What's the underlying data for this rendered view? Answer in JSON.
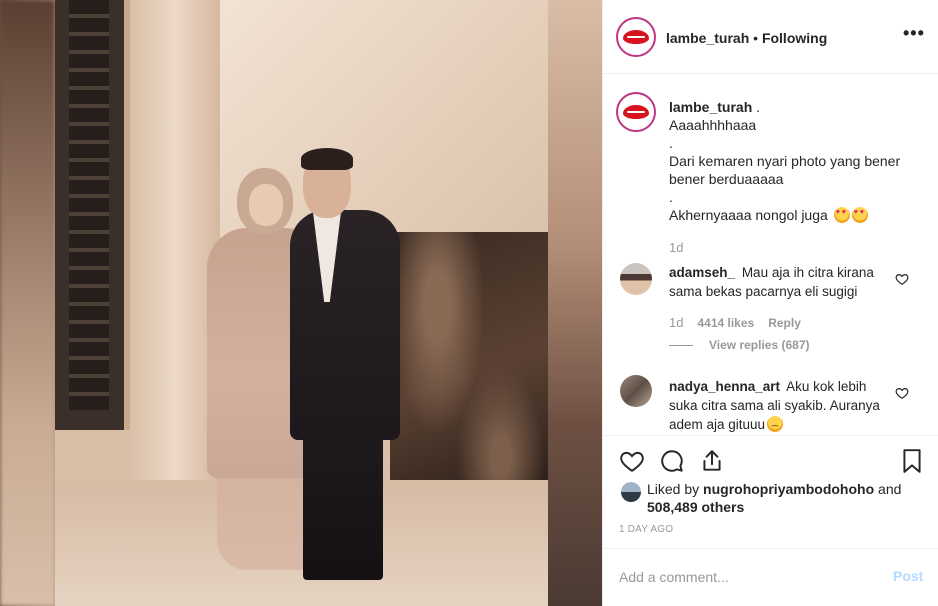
{
  "post": {
    "username": "lambe_turah",
    "separator": "•",
    "follow_status": "Following",
    "more_label": "•••"
  },
  "caption": {
    "username": "lambe_turah",
    "lines": [
      ".",
      "Aaaahhhhaaa",
      ".",
      "Dari kemaren nyari photo yang bener",
      "bener berduaaaaa",
      ".",
      "Akhernyaaaa nongol juga"
    ],
    "time": "1d"
  },
  "comments": [
    {
      "username": "adamseh_",
      "text": "Mau aja ih citra kirana sama bekas pacarnya eli sugigi",
      "time": "1d",
      "likes": "4414 likes",
      "reply_label": "Reply",
      "view_replies": "View replies (687)"
    },
    {
      "username": "nadya_henna_art",
      "text": "Aku kok lebih suka citra sama ali syakib. Auranya adem aja gituuu"
    }
  ],
  "likes": {
    "prefix": "Liked by",
    "user": "nugrohopriyambodohoho",
    "conjunction": "and",
    "others": "508,489 others"
  },
  "time_ago": "1 DAY AGO",
  "add_comment": {
    "placeholder": "Add a comment...",
    "post_label": "Post"
  },
  "icons": {
    "like": "heart-outline-icon",
    "comment": "speech-bubble-icon",
    "share": "share-upload-icon",
    "save": "bookmark-icon",
    "more": "more-options-icon"
  },
  "colors": {
    "brand_ring": "#c13584",
    "text": "#262626",
    "muted": "#999999",
    "post_disabled": "#b3dbff"
  }
}
